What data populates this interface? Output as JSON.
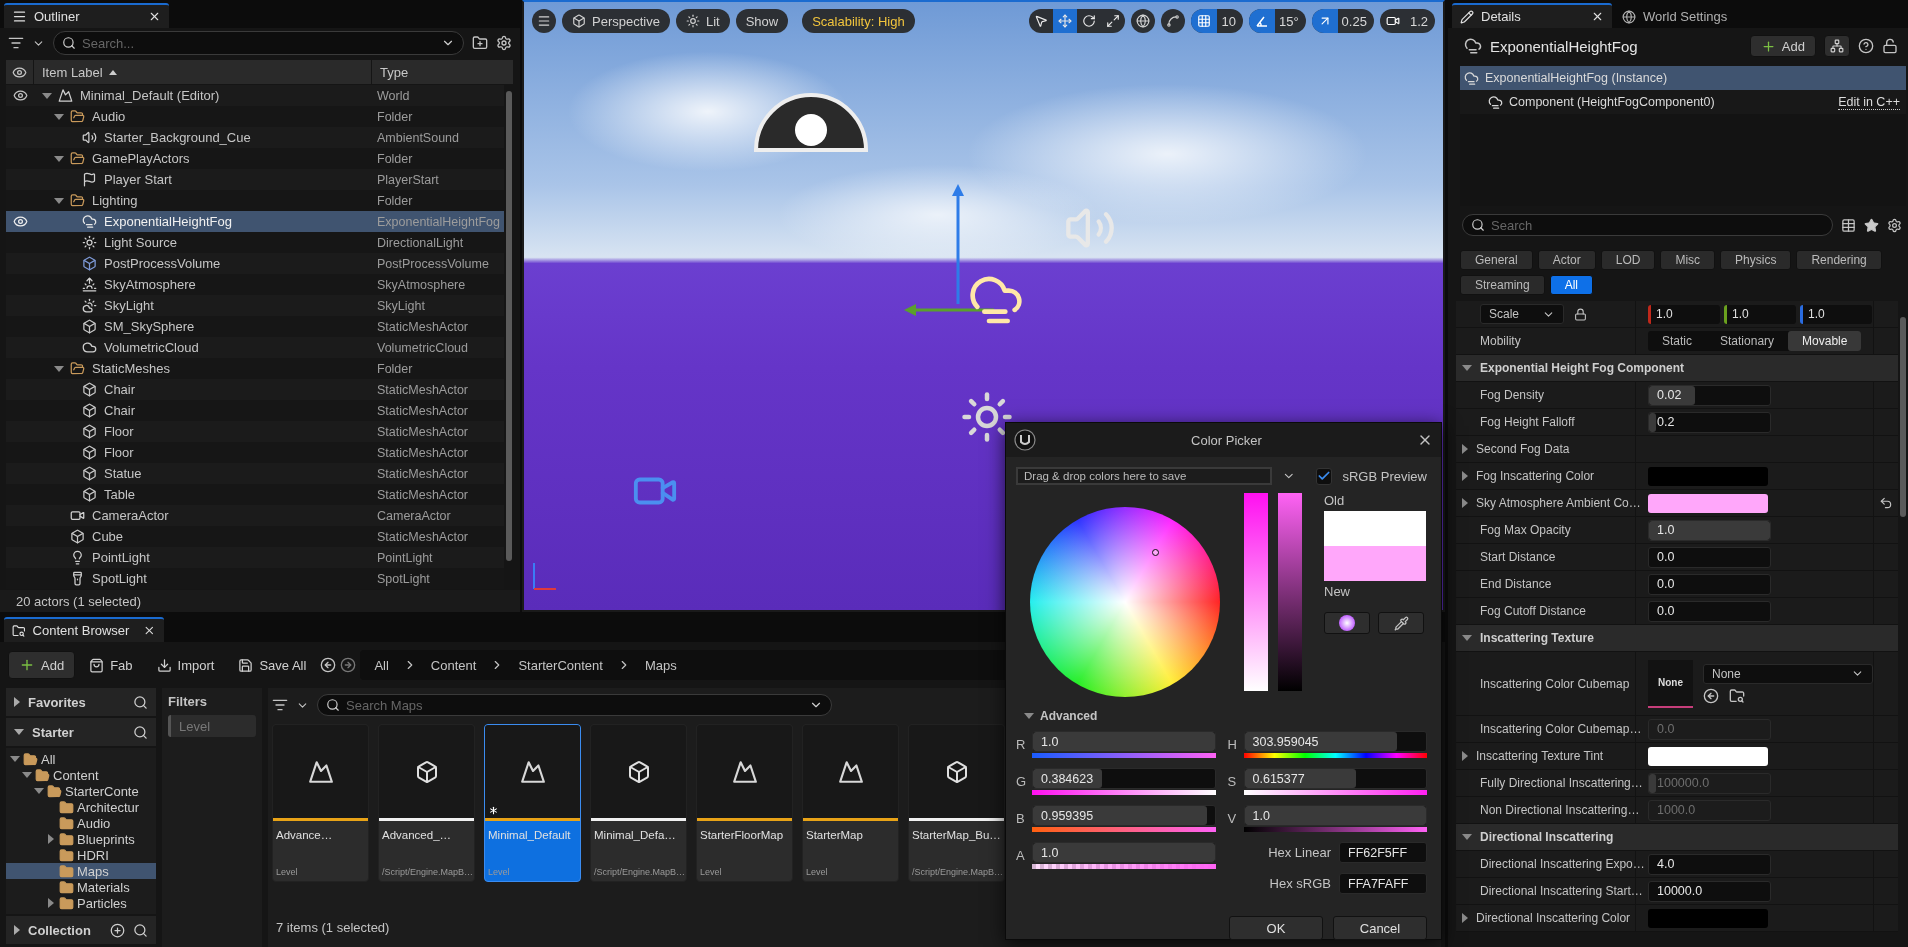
{
  "outliner": {
    "tab": "Outliner",
    "search_placeholder": "Search...",
    "columns": [
      "Item Label",
      "Type"
    ],
    "tree": [
      {
        "label": "Minimal_Default (Editor)",
        "type": "World",
        "kind": "world",
        "selected": false,
        "eye": true,
        "expanded": true,
        "children": [
          {
            "label": "Audio",
            "type": "Folder",
            "kind": "folder",
            "selected": false,
            "eye": false,
            "expanded": true,
            "children": [
              {
                "label": "Starter_Background_Cue",
                "type": "AmbientSound",
                "kind": "sound",
                "selected": false,
                "eye": false
              }
            ]
          },
          {
            "label": "GamePlayActors",
            "type": "Folder",
            "kind": "folder",
            "selected": false,
            "eye": false,
            "expanded": true,
            "children": [
              {
                "label": "Player Start",
                "type": "PlayerStart",
                "kind": "playerstart",
                "selected": false,
                "eye": false
              }
            ]
          },
          {
            "label": "Lighting",
            "type": "Folder",
            "kind": "folder",
            "selected": false,
            "eye": false,
            "expanded": true,
            "children": [
              {
                "label": "ExponentialHeightFog",
                "type": "ExponentialHeightFog",
                "kind": "fog",
                "selected": true,
                "eye": true
              },
              {
                "label": "Light Source",
                "type": "DirectionalLight",
                "kind": "light",
                "selected": false,
                "eye": false
              },
              {
                "label": "PostProcessVolume",
                "type": "PostProcessVolume",
                "kind": "volume",
                "selected": false,
                "eye": false
              },
              {
                "label": "SkyAtmosphere",
                "type": "SkyAtmosphere",
                "kind": "sky",
                "selected": false,
                "eye": false
              },
              {
                "label": "SkyLight",
                "type": "SkyLight",
                "kind": "skylight",
                "selected": false,
                "eye": false
              },
              {
                "label": "SM_SkySphere",
                "type": "StaticMeshActor",
                "kind": "mesh",
                "selected": false,
                "eye": false
              },
              {
                "label": "VolumetricCloud",
                "type": "VolumetricCloud",
                "kind": "cloud",
                "selected": false,
                "eye": false
              }
            ]
          },
          {
            "label": "StaticMeshes",
            "type": "Folder",
            "kind": "folder",
            "selected": false,
            "eye": false,
            "expanded": true,
            "children": [
              {
                "label": "Chair",
                "type": "StaticMeshActor",
                "kind": "mesh",
                "selected": false,
                "eye": false
              },
              {
                "label": "Chair",
                "type": "StaticMeshActor",
                "kind": "mesh",
                "selected": false,
                "eye": false
              },
              {
                "label": "Floor",
                "type": "StaticMeshActor",
                "kind": "mesh",
                "selected": false,
                "eye": false
              },
              {
                "label": "Floor",
                "type": "StaticMeshActor",
                "kind": "mesh",
                "selected": false,
                "eye": false
              },
              {
                "label": "Statue",
                "type": "StaticMeshActor",
                "kind": "mesh",
                "selected": false,
                "eye": false
              },
              {
                "label": "Table",
                "type": "StaticMeshActor",
                "kind": "mesh",
                "selected": false,
                "eye": false
              }
            ]
          },
          {
            "label": "CameraActor",
            "type": "CameraActor",
            "kind": "camera",
            "selected": false,
            "eye": false
          },
          {
            "label": "Cube",
            "type": "StaticMeshActor",
            "kind": "mesh",
            "selected": false,
            "eye": false
          },
          {
            "label": "PointLight",
            "type": "PointLight",
            "kind": "pointlight",
            "selected": false,
            "eye": false
          },
          {
            "label": "SpotLight",
            "type": "SpotLight",
            "kind": "spotlight",
            "selected": false,
            "eye": false
          }
        ]
      }
    ],
    "status": "20 actors (1 selected)"
  },
  "viewport": {
    "buttons": [
      {
        "kind": "menu"
      },
      {
        "kind": "perspective",
        "label": "Perspective"
      },
      {
        "kind": "lit",
        "label": "Lit"
      },
      {
        "kind": "plain",
        "label": "Show"
      },
      {
        "kind": "scalability",
        "label": "Scalability: High"
      }
    ],
    "tools": [
      {
        "kind": "select",
        "selected": false
      },
      {
        "kind": "move",
        "selected": true
      },
      {
        "kind": "rotate",
        "selected": false
      },
      {
        "kind": "scale",
        "selected": false
      }
    ],
    "snaps": [
      {
        "kind": "grid",
        "value": "10",
        "on": true
      },
      {
        "kind": "angle",
        "value": "15°",
        "on": true
      },
      {
        "kind": "scale",
        "value": "0.25",
        "on": true
      },
      {
        "kind": "camera",
        "value": "1.2",
        "on": false
      }
    ]
  },
  "content_browser": {
    "tab": "Content Browser",
    "toolbar": [
      {
        "kind": "add",
        "label": "Add"
      },
      {
        "kind": "fab",
        "label": "Fab"
      },
      {
        "kind": "import",
        "label": "Import"
      },
      {
        "kind": "save",
        "label": "Save All"
      }
    ],
    "breadcrumb": [
      "All",
      "Content",
      "StarterContent",
      "Maps"
    ],
    "favorites": {
      "label": "Favorites",
      "expanded": false
    },
    "starter": {
      "label": "Starter",
      "expanded": true,
      "tree": [
        {
          "label": "All",
          "selected": false,
          "expanded": true,
          "children": [
            {
              "label": "Content",
              "selected": false,
              "expanded": true,
              "children": [
                {
                  "label": "StarterConte",
                  "selected": false,
                  "expanded": true,
                  "children": [
                    {
                      "label": "Architectur",
                      "selected": false
                    },
                    {
                      "label": "Audio",
                      "selected": false
                    },
                    {
                      "label": "Blueprints",
                      "selected": false,
                      "expanded": false
                    },
                    {
                      "label": "HDRI",
                      "selected": false
                    },
                    {
                      "label": "Maps",
                      "selected": true
                    },
                    {
                      "label": "Materials",
                      "selected": false
                    },
                    {
                      "label": "Particles",
                      "selected": false,
                      "expanded": false
                    }
                  ]
                }
              ]
            }
          ]
        }
      ]
    },
    "collection": {
      "label": "Collection",
      "expanded": false
    },
    "filters": {
      "title": "Filters",
      "chips": [
        "Level"
      ]
    },
    "search_placeholder": "Search Maps",
    "assets": [
      {
        "name": "Advance…",
        "type": "Level",
        "kind": "level",
        "selected": false,
        "modified": false
      },
      {
        "name": "Advanced_…",
        "type": "/Script/Engine.MapB…",
        "kind": "build_data",
        "selected": false,
        "modified": false
      },
      {
        "name": "Minimal_Default",
        "type": "Level",
        "kind": "level",
        "selected": true,
        "modified": true
      },
      {
        "name": "Minimal_Defa…",
        "type": "/Script/Engine.MapB…",
        "kind": "build_data",
        "selected": false,
        "modified": false
      },
      {
        "name": "StarterFloorMap",
        "type": "Level",
        "kind": "level",
        "selected": false,
        "modified": false
      },
      {
        "name": "StarterMap",
        "type": "Level",
        "kind": "level",
        "selected": false,
        "modified": false
      },
      {
        "name": "StarterMap_Bu…",
        "type": "/Script/Engine.MapB…",
        "kind": "build_data",
        "selected": false,
        "modified": false
      }
    ],
    "status": "7 items (1 selected)"
  },
  "color_picker": {
    "title": "Color Picker",
    "save_hint": "Drag & drop colors here to save",
    "srgb": {
      "label": "sRGB Preview",
      "checked": true
    },
    "old": {
      "label": "Old",
      "color": "#ffffff"
    },
    "new": {
      "label": "New",
      "color": "#ffa7fa"
    },
    "advanced": {
      "label": "Advanced",
      "expanded": true
    },
    "rgba": [
      {
        "kind": "r",
        "label": "R",
        "value": "1.0",
        "level": 1
      },
      {
        "kind": "g",
        "label": "G",
        "value": "0.384623",
        "level": 0.38
      },
      {
        "kind": "b",
        "label": "B",
        "value": "0.959395",
        "level": 0.96
      },
      {
        "kind": "a",
        "label": "A",
        "value": "1.0",
        "level": 1
      }
    ],
    "hsv": [
      {
        "kind": "h",
        "label": "H",
        "value": "303.959045",
        "level": 0.84
      },
      {
        "kind": "s",
        "label": "S",
        "value": "0.615377",
        "level": 0.615
      },
      {
        "kind": "v",
        "label": "V",
        "value": "1.0",
        "level": 1
      }
    ],
    "hex": [
      {
        "label": "Hex Linear",
        "value": "FF62F5FF"
      },
      {
        "label": "Hex sRGB",
        "value": "FFA7FAFF"
      }
    ],
    "buttons": [
      "OK",
      "Cancel"
    ]
  },
  "details": {
    "tabs": [
      {
        "kind": "details",
        "label": "Details",
        "selected": true
      },
      {
        "kind": "world",
        "label": "World Settings",
        "selected": false
      }
    ],
    "title": "ExponentialHeightFog",
    "add": "Add",
    "components": [
      {
        "label": "ExponentialHeightFog (Instance)",
        "selected": true
      },
      {
        "label": "Component (HeightFogComponent0)",
        "selected": false,
        "link": "Edit in C++"
      }
    ],
    "search_placeholder": "Search",
    "filters": [
      {
        "label": "General",
        "selected": false
      },
      {
        "label": "Actor",
        "selected": false
      },
      {
        "label": "LOD",
        "selected": false
      },
      {
        "label": "Misc",
        "selected": false
      },
      {
        "label": "Physics",
        "selected": false
      },
      {
        "label": "Rendering",
        "selected": false
      },
      {
        "label": "Streaming",
        "selected": false
      },
      {
        "label": "All",
        "selected": true
      }
    ],
    "properties": [
      {
        "kind": "vector",
        "label": "Scale",
        "values": [
          "1.0",
          "1.0",
          "1.0"
        ]
      },
      {
        "kind": "segmented",
        "label": "Mobility",
        "options": [
          {
            "label": "Static",
            "selected": false
          },
          {
            "label": "Stationary",
            "selected": false
          },
          {
            "label": "Movable",
            "selected": true
          }
        ]
      },
      {
        "kind": "section",
        "label": "Exponential Height Fog Component",
        "expanded": true
      },
      {
        "kind": "number",
        "label": "Fog Density",
        "value": "0.02",
        "disabled": false,
        "level": 0.38
      },
      {
        "kind": "number",
        "label": "Fog Height Falloff",
        "value": "0.2",
        "disabled": false,
        "level": 0.06
      },
      {
        "kind": "group",
        "label": "Second Fog Data",
        "expanded": false
      },
      {
        "kind": "color",
        "label": "Fog Inscattering Color",
        "color": "#000000",
        "expanded": false,
        "reset": false
      },
      {
        "kind": "color",
        "label": "Sky Atmosphere Ambient Co…",
        "color": "#ffa7fa",
        "expanded": false,
        "reset": true
      },
      {
        "kind": "number",
        "label": "Fog Max Opacity",
        "value": "1.0",
        "disabled": false,
        "level": 1
      },
      {
        "kind": "number",
        "label": "Start Distance",
        "value": "0.0",
        "disabled": false
      },
      {
        "kind": "number",
        "label": "End Distance",
        "value": "0.0",
        "disabled": false
      },
      {
        "kind": "number",
        "label": "Fog Cutoff Distance",
        "value": "0.0",
        "disabled": false
      },
      {
        "kind": "section",
        "label": "Inscattering Texture",
        "expanded": true
      },
      {
        "kind": "asset",
        "label": "Inscattering Color Cubemap",
        "thumb": "None",
        "value": "None"
      },
      {
        "kind": "number",
        "label": "Inscattering Color Cubemap…",
        "value": "0.0",
        "disabled": true
      },
      {
        "kind": "color",
        "label": "Inscattering Texture Tint",
        "color": "#ffffff",
        "expanded": false,
        "reset": false
      },
      {
        "kind": "number",
        "label": "Fully Directional Inscattering…",
        "value": "100000.0",
        "disabled": true,
        "level": 0.06
      },
      {
        "kind": "number",
        "label": "Non Directional Inscattering…",
        "value": "1000.0",
        "disabled": true
      },
      {
        "kind": "section",
        "label": "Directional Inscattering",
        "expanded": true
      },
      {
        "kind": "number",
        "label": "Directional Inscattering Expo…",
        "value": "4.0",
        "disabled": false
      },
      {
        "kind": "number",
        "label": "Directional Inscattering Start…",
        "value": "10000.0",
        "disabled": false
      },
      {
        "kind": "color",
        "label": "Directional Inscattering Color",
        "color": "#000000",
        "expanded": false,
        "reset": false
      }
    ]
  }
}
